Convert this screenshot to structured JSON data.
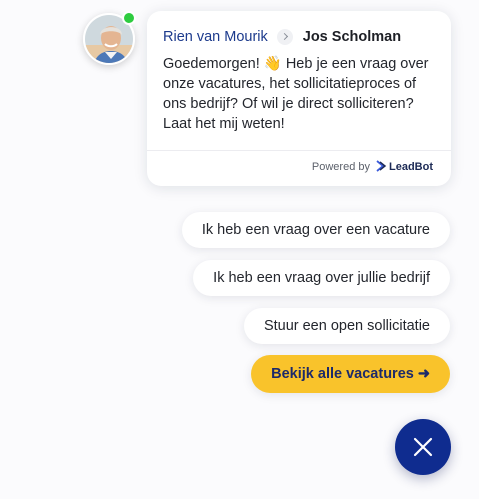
{
  "colors": {
    "online": "#2ecc40",
    "primary_button": "#f9c32b",
    "close_button": "#0f2c8f",
    "agent_name": "#1c3a8c"
  },
  "header": {
    "agent_name": "Rien van Mourik",
    "company_name": "Jos Scholman"
  },
  "message": {
    "text": "Goedemorgen! 👋 Heb je een vraag over onze vacatures, het sollicitatieproces of ons bedrijf? Of wil je direct solliciteren? Laat het mij weten!"
  },
  "footer": {
    "powered_by": "Powered by",
    "brand": "LeadBot"
  },
  "quick_replies": [
    {
      "label": "Ik heb een vraag over een vacature"
    },
    {
      "label": "Ik heb een vraag over jullie bedrijf"
    },
    {
      "label": "Stuur een open sollicitatie"
    },
    {
      "label": "Bekijk alle vacatures ➜",
      "primary": true
    }
  ],
  "icons": {
    "avatar": "agent-avatar",
    "status": "online-status-icon",
    "separator": "chevron-right-icon",
    "brand_logo": "leadbot-logo-icon",
    "close": "close-icon"
  }
}
